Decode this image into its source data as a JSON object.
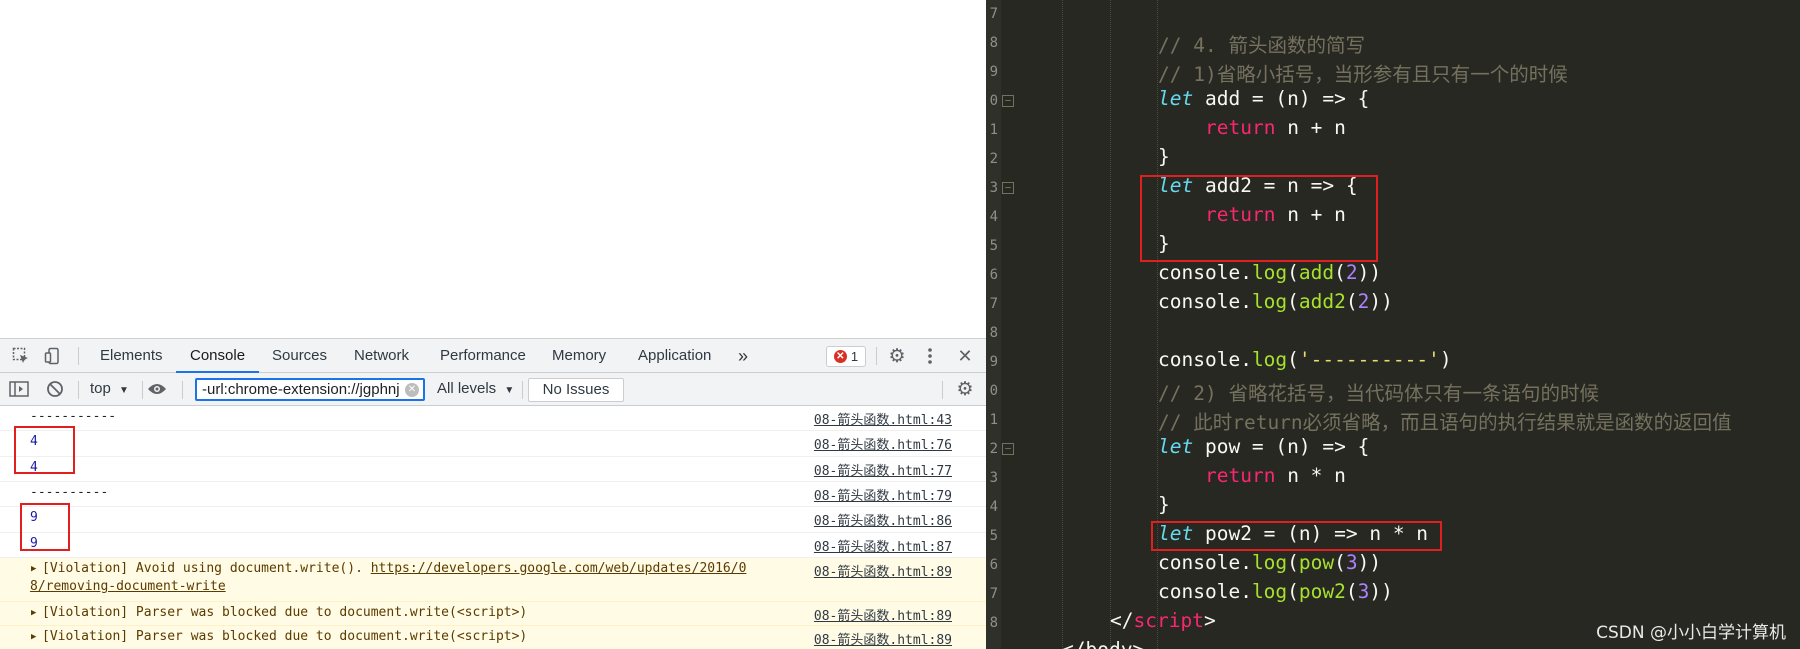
{
  "devtools": {
    "tabs": [
      "Elements",
      "Console",
      "Sources",
      "Network",
      "Performance",
      "Memory",
      "Application"
    ],
    "active_tab": "Console",
    "more_tabs_label": "»",
    "error_count": "1",
    "context": "top",
    "filter_value": "-url:chrome-extension://jgphnj",
    "levels": "All levels",
    "issues_label": "No Issues"
  },
  "console": {
    "rows": [
      {
        "message": "-----------",
        "source": "08-箭头函数.html:43"
      },
      {
        "message": "4",
        "source": "08-箭头函数.html:76"
      },
      {
        "message": "4",
        "source": "08-箭头函数.html:77"
      },
      {
        "message": "----------",
        "source": "08-箭头函数.html:79"
      },
      {
        "message": "9",
        "source": "08-箭头函数.html:86"
      },
      {
        "message": "9",
        "source": "08-箭头函数.html:87"
      }
    ],
    "warnings": [
      {
        "prefix": "[Violation] Avoid using document.write(). ",
        "link": "https://developers.google.com/web/updates/2016/0",
        "line2": "8/removing-document-write",
        "source": "08-箭头函数.html:89"
      },
      {
        "message": "[Violation] Parser was blocked due to document.write(<script>)",
        "source": "08-箭头函数.html:89"
      },
      {
        "message": "[Violation] Parser was blocked due to document.write(<script>)",
        "source": "08-箭头函数.html:89"
      }
    ]
  },
  "editor": {
    "line_numbers": [
      "7",
      "8",
      "9",
      "0",
      "1",
      "2",
      "3",
      "4",
      "5",
      "6",
      "7",
      "8",
      "9",
      "0",
      "1",
      "2",
      "3",
      "4",
      "5",
      "6",
      "7",
      "8"
    ],
    "code": {
      "c1": "// 4. 箭头函数的简写",
      "c2": "// 1)省略小括号，当形参有且只有一个的时候",
      "c3": "// 2) 省略花括号，当代码体只有一条语句的时候",
      "c4": "// 此时return必须省略，而且语句的执行结果就是函数的返回值",
      "let": "let",
      "return": "return",
      "console": "console",
      "log": "log",
      "add_decl": " add = (n) => {",
      "add2_decl": " add2 = n => {",
      "pow_decl": " pow = (n) => {",
      "pow2_decl": " pow2 = (n) => n * n",
      "ret_body_plus": " n + n",
      "ret_body_times": " n * n",
      "close_brace": "}",
      "add": "add",
      "add2": "add2",
      "pow": "pow",
      "pow2": "pow2",
      "arg2": "2",
      "arg3": "3",
      "dash_str": "'----------'",
      "script_close_pre": "</",
      "script_tag": "script",
      "script_close_post": ">",
      "body_partial": "</body>"
    },
    "watermark": "CSDN @小小白学计算机"
  }
}
